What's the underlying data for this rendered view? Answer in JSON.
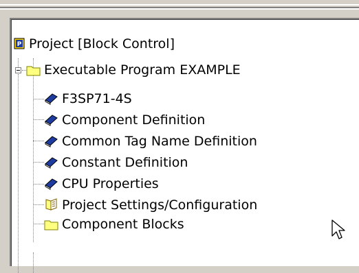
{
  "tree": {
    "root": {
      "label": "Project [Block Control]",
      "icon": "project-icon"
    },
    "program": {
      "label": "Executable Program EXAMPLE",
      "icon": "folder-icon"
    },
    "children": [
      {
        "label": "F3SP71-4S",
        "icon": "book-icon"
      },
      {
        "label": "Component Definition",
        "icon": "book-icon"
      },
      {
        "label": "Common Tag Name Definition",
        "icon": "book-icon"
      },
      {
        "label": "Constant Definition",
        "icon": "book-icon"
      },
      {
        "label": "CPU Properties",
        "icon": "book-icon"
      },
      {
        "label": "Project Settings/Configuration",
        "icon": "open-book-icon"
      },
      {
        "label": "Component Blocks",
        "icon": "folder-icon"
      }
    ]
  },
  "colors": {
    "folder": "#ffff80",
    "book": "#1e3ca0",
    "project": "#ffd800"
  }
}
